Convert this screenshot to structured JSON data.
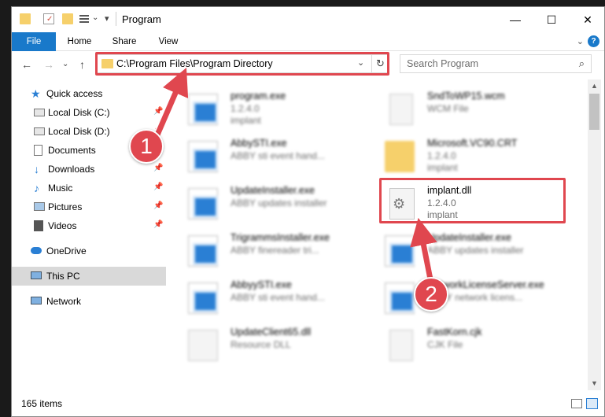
{
  "window": {
    "title": "Program",
    "controls": {
      "minimize": "—",
      "maximize": "☐",
      "close": "✕"
    }
  },
  "ribbon": {
    "tabs": [
      "File",
      "Home",
      "Share",
      "View"
    ],
    "expand": "⌄",
    "help": "?"
  },
  "nav": {
    "back": "←",
    "forward": "→",
    "recent": "⌄",
    "up": "↑",
    "address": "C:\\Program Files\\Program Directory",
    "dropdown": "⌄",
    "refresh": "↻",
    "search_placeholder": "Search Program",
    "search_icon": "⌕"
  },
  "sidebar": {
    "items": [
      {
        "label": "Quick access",
        "icon": "star-icon",
        "pinned": false
      },
      {
        "label": "Local Disk (C:)",
        "icon": "drive-icon",
        "pinned": true
      },
      {
        "label": "Local Disk (D:)",
        "icon": "drive-icon",
        "pinned": true
      },
      {
        "label": "Documents",
        "icon": "documents-icon",
        "pinned": true
      },
      {
        "label": "Downloads",
        "icon": "download-icon",
        "pinned": true
      },
      {
        "label": "Music",
        "icon": "music-icon",
        "pinned": true
      },
      {
        "label": "Pictures",
        "icon": "pictures-icon",
        "pinned": true
      },
      {
        "label": "Videos",
        "icon": "videos-icon",
        "pinned": true
      },
      {
        "label": "OneDrive",
        "icon": "cloud-icon",
        "pinned": false
      },
      {
        "label": "This PC",
        "icon": "pc-icon",
        "pinned": false,
        "selected": true
      },
      {
        "label": "Network",
        "icon": "network-icon",
        "pinned": false
      }
    ],
    "pin_glyph": "📌"
  },
  "files": {
    "left": [
      {
        "name": "program.exe",
        "line1": "1.2.4.0",
        "line2": "implant"
      },
      {
        "name": "AbbySTI.exe",
        "line1": "ABBY sti event hand...",
        "line2": ""
      },
      {
        "name": "UpdateInstaller.exe",
        "line1": "ABBY updates installer",
        "line2": ""
      },
      {
        "name": "TrigrammsInstaller.exe",
        "line1": "ABBY finereader tri...",
        "line2": ""
      },
      {
        "name": "AbbyySTI.exe",
        "line1": "ABBY sti event hand...",
        "line2": ""
      },
      {
        "name": "UpdateClient65.dll",
        "line1": "Resource DLL",
        "line2": ""
      }
    ],
    "right": [
      {
        "name": "SndToWP15.wcm",
        "line1": "WCM File",
        "line2": ""
      },
      {
        "name": "Microsoft.VC90.CRT",
        "line1": "1.2.4.0",
        "line2": "implant"
      },
      {
        "name": "implant.dll",
        "line1": "1.2.4.0",
        "line2": "implant"
      },
      {
        "name": "UpdateInstaller.exe",
        "line1": "ABBY updates installer",
        "line2": ""
      },
      {
        "name": "NetworkLicenseServer.exe",
        "line1": "ABBY network licens...",
        "line2": ""
      },
      {
        "name": "FastKorn.cjk",
        "line1": "CJK File",
        "line2": ""
      }
    ]
  },
  "status": {
    "count": "165 items"
  },
  "scrollbar": {
    "up": "▲",
    "down": "▼"
  },
  "annotations": {
    "badge1": "1",
    "badge2": "2"
  },
  "colors": {
    "accent": "#1979ca",
    "highlight": "#e0474f"
  }
}
